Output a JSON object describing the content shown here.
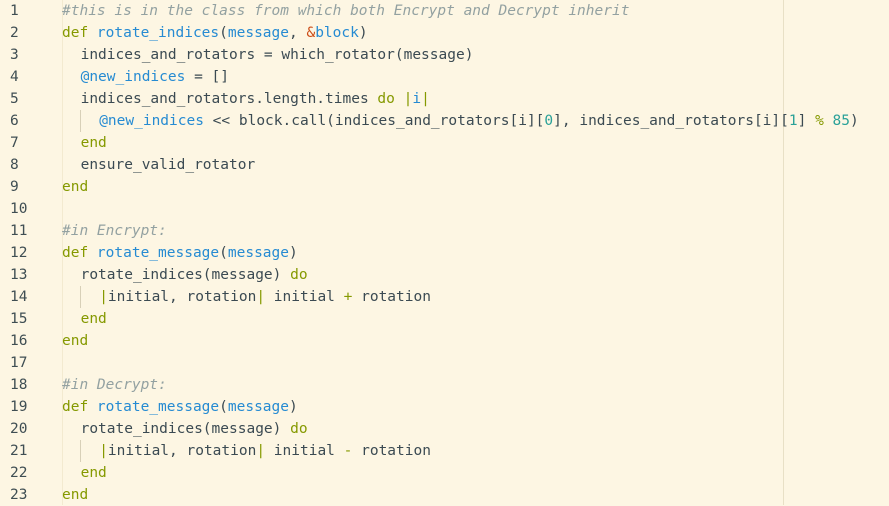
{
  "editor": {
    "lines": [
      {
        "num": "1",
        "indent": 0,
        "tokens": [
          {
            "t": "#this is in the class from which both Encrypt and Decrypt inherit",
            "c": "comment"
          }
        ]
      },
      {
        "num": "2",
        "indent": 0,
        "tokens": [
          {
            "t": "def ",
            "c": "keyword"
          },
          {
            "t": "rotate_indices",
            "c": "method"
          },
          {
            "t": "(",
            "c": "plain"
          },
          {
            "t": "message",
            "c": "param"
          },
          {
            "t": ", ",
            "c": "plain"
          },
          {
            "t": "&",
            "c": "amp"
          },
          {
            "t": "block",
            "c": "block"
          },
          {
            "t": ")",
            "c": "plain"
          }
        ]
      },
      {
        "num": "3",
        "indent": 1,
        "tokens": [
          {
            "t": "indices_and_rotators = which_rotator(message)",
            "c": "plain"
          }
        ]
      },
      {
        "num": "4",
        "indent": 1,
        "tokens": [
          {
            "t": "@new_indices",
            "c": "ivar"
          },
          {
            "t": " = []",
            "c": "plain"
          }
        ]
      },
      {
        "num": "5",
        "indent": 1,
        "tokens": [
          {
            "t": "indices_and_rotators.length.times ",
            "c": "plain"
          },
          {
            "t": "do",
            "c": "keyword"
          },
          {
            "t": " ",
            "c": "plain"
          },
          {
            "t": "|",
            "c": "pipe"
          },
          {
            "t": "i",
            "c": "param"
          },
          {
            "t": "|",
            "c": "pipe"
          }
        ]
      },
      {
        "num": "6",
        "indent": 2,
        "tokens": [
          {
            "t": "@new_indices",
            "c": "ivar"
          },
          {
            "t": " << block.call(indices_and_rotators[i][",
            "c": "plain"
          },
          {
            "t": "0",
            "c": "number"
          },
          {
            "t": "], indices_and_rotators[i][",
            "c": "plain"
          },
          {
            "t": "1",
            "c": "number"
          },
          {
            "t": "] ",
            "c": "plain"
          },
          {
            "t": "%",
            "c": "mod"
          },
          {
            "t": " ",
            "c": "plain"
          },
          {
            "t": "85",
            "c": "number"
          },
          {
            "t": ")",
            "c": "plain"
          }
        ]
      },
      {
        "num": "7",
        "indent": 1,
        "tokens": [
          {
            "t": "end",
            "c": "keyword"
          }
        ]
      },
      {
        "num": "8",
        "indent": 1,
        "tokens": [
          {
            "t": "ensure_valid_rotator",
            "c": "plain"
          }
        ]
      },
      {
        "num": "9",
        "indent": 0,
        "tokens": [
          {
            "t": "end",
            "c": "keyword"
          }
        ]
      },
      {
        "num": "10",
        "indent": 0,
        "tokens": []
      },
      {
        "num": "11",
        "indent": 0,
        "tokens": [
          {
            "t": "#in Encrypt:",
            "c": "comment"
          }
        ]
      },
      {
        "num": "12",
        "indent": 0,
        "tokens": [
          {
            "t": "def ",
            "c": "keyword"
          },
          {
            "t": "rotate_message",
            "c": "method"
          },
          {
            "t": "(",
            "c": "plain"
          },
          {
            "t": "message",
            "c": "param"
          },
          {
            "t": ")",
            "c": "plain"
          }
        ]
      },
      {
        "num": "13",
        "indent": 1,
        "tokens": [
          {
            "t": "rotate_indices(message) ",
            "c": "plain"
          },
          {
            "t": "do",
            "c": "keyword"
          }
        ]
      },
      {
        "num": "14",
        "indent": 2,
        "tokens": [
          {
            "t": "|",
            "c": "pipe"
          },
          {
            "t": "initial, rotation",
            "c": "plain"
          },
          {
            "t": "|",
            "c": "pipe"
          },
          {
            "t": " initial ",
            "c": "plain"
          },
          {
            "t": "+",
            "c": "mod"
          },
          {
            "t": " rotation",
            "c": "plain"
          }
        ]
      },
      {
        "num": "15",
        "indent": 1,
        "tokens": [
          {
            "t": "end",
            "c": "keyword"
          }
        ]
      },
      {
        "num": "16",
        "indent": 0,
        "tokens": [
          {
            "t": "end",
            "c": "keyword"
          }
        ]
      },
      {
        "num": "17",
        "indent": 0,
        "tokens": []
      },
      {
        "num": "18",
        "indent": 0,
        "tokens": [
          {
            "t": "#in Decrypt:",
            "c": "comment"
          }
        ]
      },
      {
        "num": "19",
        "indent": 0,
        "tokens": [
          {
            "t": "def ",
            "c": "keyword"
          },
          {
            "t": "rotate_message",
            "c": "method"
          },
          {
            "t": "(",
            "c": "plain"
          },
          {
            "t": "message",
            "c": "param"
          },
          {
            "t": ")",
            "c": "plain"
          }
        ]
      },
      {
        "num": "20",
        "indent": 1,
        "tokens": [
          {
            "t": "rotate_indices(message) ",
            "c": "plain"
          },
          {
            "t": "do",
            "c": "keyword"
          }
        ]
      },
      {
        "num": "21",
        "indent": 2,
        "tokens": [
          {
            "t": "|",
            "c": "pipe"
          },
          {
            "t": "initial, rotation",
            "c": "plain"
          },
          {
            "t": "|",
            "c": "pipe"
          },
          {
            "t": " initial ",
            "c": "plain"
          },
          {
            "t": "-",
            "c": "mod"
          },
          {
            "t": " rotation",
            "c": "plain"
          }
        ]
      },
      {
        "num": "22",
        "indent": 1,
        "tokens": [
          {
            "t": "end",
            "c": "keyword"
          }
        ]
      },
      {
        "num": "23",
        "indent": 0,
        "tokens": [
          {
            "t": "end",
            "c": "keyword"
          }
        ]
      }
    ]
  }
}
